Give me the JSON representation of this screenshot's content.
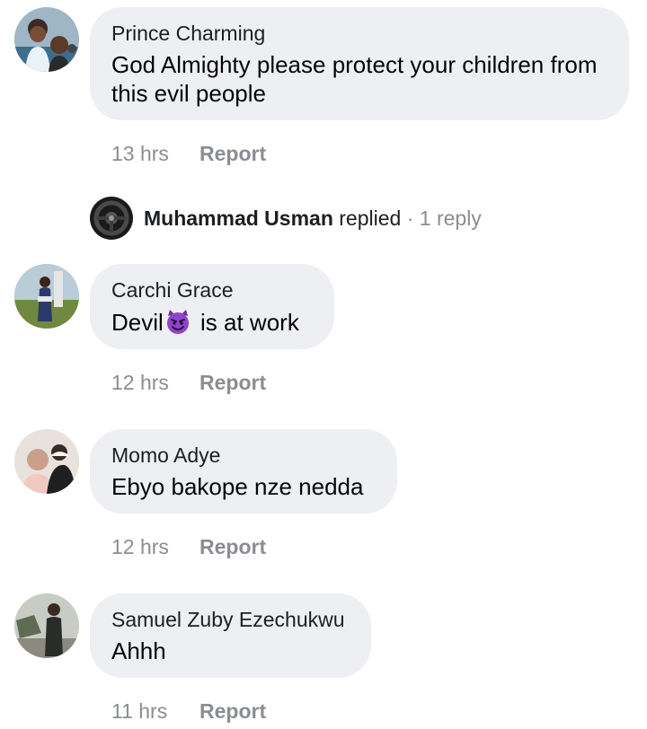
{
  "comments": [
    {
      "author": "Prince Charming",
      "text": "God Almighty please protect your children from this evil people",
      "time": "13 hrs",
      "report_label": "Report",
      "avatar_icon": "user-avatar-icon"
    },
    {
      "author": "Carchi Grace",
      "text_before": "Devil",
      "text_after": " is at work",
      "emoji_icon": "smiling-devil-emoji-icon",
      "time": "12 hrs",
      "report_label": "Report",
      "avatar_icon": "user-avatar-icon"
    },
    {
      "author": "Momo Adye",
      "text": "Ebyo bakope nze nedda",
      "time": "12 hrs",
      "report_label": "Report",
      "avatar_icon": "user-avatar-icon"
    },
    {
      "author": "Samuel Zuby Ezechukwu",
      "text": "Ahhh",
      "time": "11 hrs",
      "report_label": "Report",
      "avatar_icon": "user-avatar-icon"
    }
  ],
  "reply": {
    "name": "Muhammad Usman",
    "action": "replied",
    "separator": "·",
    "count": "1 reply",
    "avatar_icon": "steering-wheel-avatar-icon"
  },
  "colors": {
    "bubble": "#eeeff2",
    "meta_text": "#8a8d91",
    "primary_text": "#050505",
    "devil_emoji": "#8e44c8"
  }
}
